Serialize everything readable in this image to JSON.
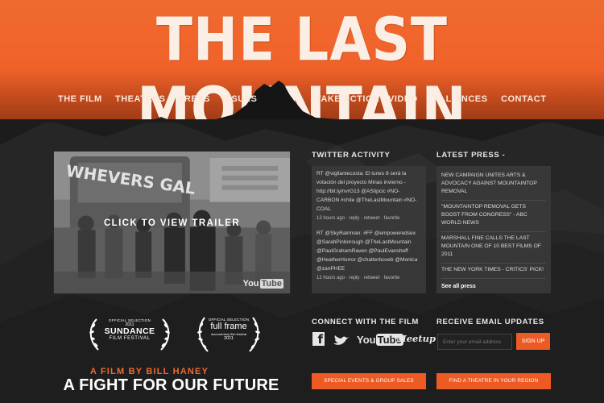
{
  "header": {
    "title": "THE LAST MOUNTAIN",
    "nav_left": [
      "THE FILM",
      "THEATRES",
      "PRESS",
      "ISSUES"
    ],
    "nav_right": [
      "TAKE ACTION",
      "VIDEO",
      "ALLIANCES",
      "CONTACT"
    ]
  },
  "trailer": {
    "label": "CLICK TO VIEW TRAILER",
    "graffiti": "WHEVERS GAL",
    "youtube_prefix": "You",
    "youtube_suffix": "Tube"
  },
  "twitter": {
    "heading": "TWITTER ACTIVITY",
    "tweets": [
      {
        "text_a": "RT @vigilantecosta: El lunes 8 será la votación del proyecto Minas invierno - ",
        "text_b": "http://bit.ly/nvrG13 @AStipcic #NO-CARBON #chile @TheLastMountain #NO-COAL",
        "meta": "13 hours ago · reply · retweet · favorite"
      },
      {
        "text_a": "RT @SkyRainman: #FF @empoweredsex @SarahPinborough @TheLastMountain @PaulGrahamRaven @PaulEvansheff",
        "text_b": "@HeatherHorror @chatterboxeb @Monica @zanPHEE",
        "meta": "12 hours ago · reply · retweet · favorite"
      }
    ]
  },
  "press": {
    "heading": "LATEST PRESS -",
    "items": [
      "NEW CAMPAIGN UNITES ARTS & ADVOCACY AGAINST MOUNTAINTOP REMOVAL",
      "\"MOUNTAINTOP REMOVAL GETS BOOST FROM CONGRESS\" - ABC WORLD NEWS",
      "MARSHALL FINE CALLS THE LAST MOUNTAIN ONE OF 10 BEST FILMS OF 2011",
      "THE NEW YORK TIMES - CRITICS' PICK!"
    ],
    "see_all": "See all press"
  },
  "laurels": {
    "sundance": {
      "line1": "OFFICIAL SELECTION",
      "year": "2011",
      "name": "SUNDANCE",
      "sub": "FILM FESTIVAL"
    },
    "fullframe": {
      "line1": "OFFICIAL SELECTION",
      "name": "full frame",
      "sub": "documentary film festival",
      "year": "2011"
    }
  },
  "tagline": {
    "film_by": "A FILM BY BILL HANEY",
    "fight": "A FIGHT FOR OUR FUTURE"
  },
  "connect": {
    "heading": "CONNECT WITH THE FILM",
    "facebook": "f",
    "youtube_prefix": "You",
    "youtube_suffix": "Tube",
    "meetup": "Meetup"
  },
  "email": {
    "heading": "RECEIVE EMAIL UPDATES",
    "placeholder": "Enter your email address",
    "button": "SIGN UP"
  },
  "buttons": {
    "events": "SPECIAL EVENTS & GROUP SALES",
    "theatre": "FIND A THEATRE IN YOUR REGION"
  },
  "colors": {
    "accent": "#ee5a24",
    "header": "#ef6a2f",
    "background": "#1c1c1c"
  }
}
